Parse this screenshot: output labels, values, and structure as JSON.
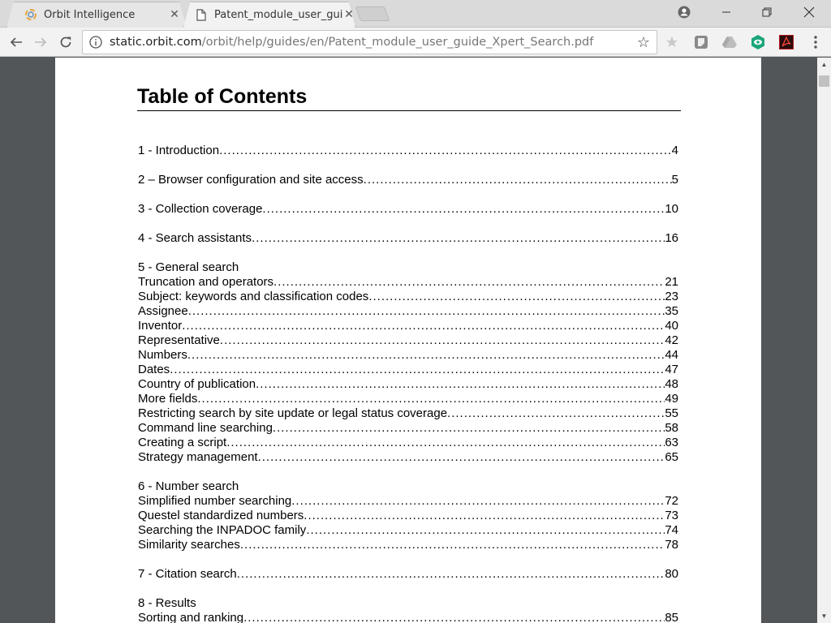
{
  "browser": {
    "tabs": [
      {
        "title": "Orbit Intelligence",
        "icon": "orbit-favicon",
        "active": false
      },
      {
        "title": "Patent_module_user_guide_Xpert_Search.pdf",
        "display_title": "Patent_module_user_guic",
        "icon": "document-icon",
        "active": true
      }
    ],
    "address": {
      "host": "static.orbit.com",
      "path": "/orbit/help/guides/en/Patent_module_user_guide_Xpert_Search.pdf"
    },
    "extensions": [
      "bookmark-star-icon",
      "extension-gray-icon",
      "google-drive-icon",
      "eye-extension-icon",
      "acrobat-icon"
    ],
    "colors": {
      "eye_ext": "#1aa67a",
      "acrobat": "#8b1010"
    }
  },
  "document": {
    "title": "Table of Contents",
    "entries": [
      {
        "label": "1 - Introduction ",
        "page": "4"
      },
      {
        "label": "2 – Browser configuration and site access",
        "page": " 5"
      },
      {
        "label": "3 - Collection coverage ",
        "page": "10"
      },
      {
        "label": "4 - Search assistants",
        "page": "16"
      }
    ],
    "sections": [
      {
        "heading": "5 - General search",
        "items": [
          {
            "label": "Truncation and operators ",
            "page": "21"
          },
          {
            "label": "Subject: keywords and classification codes",
            "page": "23"
          },
          {
            "label": "Assignee ",
            "page": "35"
          },
          {
            "label": "Inventor ",
            "page": "40"
          },
          {
            "label": "Representative ",
            "page": "42"
          },
          {
            "label": "Numbers",
            "page": "44"
          },
          {
            "label": "Dates",
            "page": "47"
          },
          {
            "label": "Country of publication",
            "page": "48"
          },
          {
            "label": "More fields ",
            "page": "49"
          },
          {
            "label": "Restricting search by site update or legal status coverage ",
            "page": "55"
          },
          {
            "label": "Command line searching",
            "page": " 58"
          },
          {
            "label": "Creating a script ",
            "page": "63"
          },
          {
            "label": "Strategy management ",
            "page": "65"
          }
        ]
      },
      {
        "heading": "6 - Number search",
        "items": [
          {
            "label": "Simplified number searching",
            "page": "72"
          },
          {
            "label": "Questel standardized numbers",
            "page": "73"
          },
          {
            "label": "Searching the INPADOC family",
            "page": "74"
          },
          {
            "label": "Similarity searches",
            "page": "78"
          }
        ]
      }
    ],
    "citation": {
      "label": "7 - Citation search",
      "page": " 80"
    },
    "results": {
      "heading": "8 - Results",
      "items": [
        {
          "label": "Sorting and ranking",
          "page": "85"
        }
      ]
    }
  }
}
